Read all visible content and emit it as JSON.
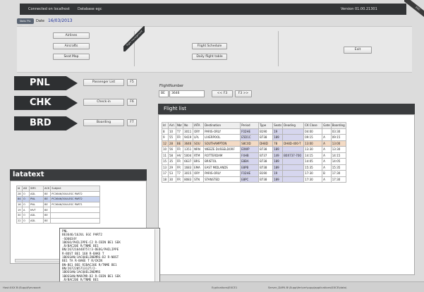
{
  "topbar": {
    "connection": "Connected on  localhost",
    "database": "Database   egc",
    "version": "Version   01.00.21301",
    "ribbon": "EGC"
  },
  "header": {
    "station_badge": "Stats F%: 8806",
    "date_label": "Date",
    "date_value": "16/03/2013"
  },
  "management": {
    "ribbon_label": "flight management",
    "buttons_left": [
      "Airlines",
      "Aircrafts",
      "Seat Map"
    ],
    "buttons_mid": [
      "Flight Schedule",
      "Daily flight table"
    ],
    "exit": "Exit"
  },
  "actions": [
    {
      "label": "PNL",
      "button": "Passenger List",
      "key": "F5"
    },
    {
      "label": "CHK",
      "button": "Check-in",
      "key": "F6"
    },
    {
      "label": "BRD",
      "button": "Boarding",
      "key": "F7"
    }
  ],
  "flight_search": {
    "flight_label": "Flight",
    "number_label": "Number",
    "flight_value": "BE",
    "number_value": "3646",
    "prev_button": "<< F3",
    "next_button": "F3 >>"
  },
  "flight_list": {
    "title": "Flight list",
    "columns": [
      "Id",
      "Airl.",
      "Nbr",
      "No",
      "IATA",
      "Destination",
      "Period",
      "Type",
      "Seats",
      "Deading",
      "CK Close",
      "Gate",
      "Boarding"
    ],
    "rows": [
      [
        "8",
        "10",
        "T7",
        "3011",
        "ORY",
        "PARIS-ORLY",
        "F02HE",
        "B190",
        "19",
        "",
        "04:00",
        "",
        "03:30"
      ],
      [
        "9",
        "55",
        "FR",
        "9419",
        "LPL",
        "LIVERPOOL",
        "E5D1C",
        "B738",
        "189",
        "",
        "09:15",
        "A",
        "09:15"
      ],
      [
        "12",
        "28",
        "BE",
        "3646",
        "SOU",
        "SOUTHAMPTON",
        "S8C0D",
        "DH8D",
        "78",
        "DH8D-400-T",
        "13:00",
        "A",
        "13:00"
      ],
      [
        "10",
        "56",
        "FR",
        "1351",
        "NRN",
        "WEEZE DUSSELDORF",
        "E0WP",
        "B738",
        "189",
        "",
        "13:30",
        "A",
        "13:30"
      ],
      [
        "11",
        "58",
        "HV",
        "5004",
        "RTM",
        "ROTTERDAM",
        "F4HB",
        "B737",
        "149",
        "B0X737-700",
        "14:15",
        "A",
        "14:15"
      ],
      [
        "15",
        "35",
        "FR",
        "6637",
        "BRS",
        "BRISTOL",
        "E8BA",
        "B738",
        "189",
        "",
        "14:05",
        "A",
        "14:05"
      ],
      [
        "13",
        "29",
        "FR",
        "1683",
        "EMA",
        "EAST MIDLANDS",
        "E8PB",
        "B738",
        "189",
        "",
        "15:35",
        "A",
        "15:35"
      ],
      [
        "17",
        "53",
        "T7",
        "3015",
        "ORY",
        "PARIS-ORLY",
        "F02HE",
        "B190",
        "19",
        "",
        "17:30",
        "B",
        "17:30"
      ],
      [
        "18",
        "30",
        "FR",
        "8083",
        "STN",
        "STANSTED",
        "E8PC",
        "B738",
        "189",
        "",
        "17:30",
        "A",
        "17:30"
      ]
    ]
  },
  "datatext": {
    "title": "latatext",
    "columns": [
      "Id",
      "AD",
      "SMS",
      "ACK",
      "Subject"
    ],
    "rows": [
      [
        "28",
        "O",
        "ADL",
        "BE",
        "PC3646/30ULESC PART2"
      ],
      [
        "84",
        "O",
        "PNL",
        "BE",
        "PC3646/30ULESC PART2"
      ],
      [
        "16",
        "O",
        "PNL",
        "BE",
        "PC3646/30ULESC PART1"
      ],
      [
        "19",
        "A",
        "MVT",
        "BE",
        ""
      ],
      [
        "30",
        "O",
        "ADL",
        "BE",
        ""
      ],
      [
        "22",
        "O",
        "ADL",
        "BE",
        ""
      ]
    ]
  },
  "popup": {
    "lines": [
      "PNL",
      "BE3646/16JUL EGC PART2",
      "-SOU034Y",
      "1BOSO/PHILIPPE-C2  R-CBIN BE1 SEK",
      ".R/BAC20E  R/TNME BE1",
      " BN/267216448757/3-DEOG/PHILIPPE",
      " R-BOST BE1 168  R-BAKE T",
      "1BOSSAN/JACQUELINEMRS-D2  R-NOST",
      " BE1 TA  R-BAKE T  R/CKIN",
      " BN-BE1 BEE RIBAC20E  R/TNME BE1",
      " BN/267220571312T/2-",
      "1BOSSAN/JACQUELINEMRS",
      "1BOSSAN/MARCMR-D2  R-CBIN BE1 SEK",
      ".R/BAC20E  R/TNME BE1"
    ]
  },
  "statusbar": {
    "left": "Host:XXX   B:\\Supp\\f\\ervaoort",
    "mid": "Eyplications\\EXCE1",
    "right": "Server_DAPA   B:\\Supp\\fer\\ver\\supp\\applications\\EXCE\\data\\"
  }
}
